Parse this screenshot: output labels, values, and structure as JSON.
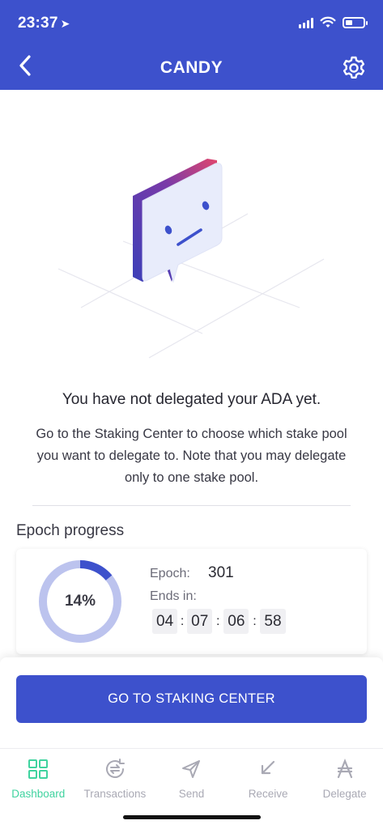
{
  "status_bar": {
    "time": "23:37"
  },
  "header": {
    "title": "CANDY"
  },
  "empty_state": {
    "heading": "You have not delegated your ADA yet.",
    "description": "Go to the Staking Center to choose which stake pool you want to delegate to. Note that you may delegate only to one stake pool."
  },
  "epoch": {
    "section_label": "Epoch progress",
    "progress_percent": 14,
    "progress_label": "14%",
    "epoch_key": "Epoch:",
    "epoch_value": "301",
    "ends_key": "Ends in:",
    "countdown": {
      "days": "04",
      "hours": "07",
      "minutes": "06",
      "seconds": "58",
      "separator": ":"
    }
  },
  "cta": {
    "label": "GO TO STAKING CENTER"
  },
  "tabs": [
    {
      "label": "Dashboard",
      "icon": "dashboard-icon",
      "active": true
    },
    {
      "label": "Transactions",
      "icon": "transactions-icon",
      "active": false
    },
    {
      "label": "Send",
      "icon": "send-icon",
      "active": false
    },
    {
      "label": "Receive",
      "icon": "receive-icon",
      "active": false
    },
    {
      "label": "Delegate",
      "icon": "ada-icon",
      "active": false
    }
  ],
  "colors": {
    "brand": "#3d51cc",
    "active_tab": "#3fd39f",
    "inactive_tab": "#a9a9b4",
    "progress_track": "#bcc3ee",
    "progress_fill": "#3d51cc"
  }
}
